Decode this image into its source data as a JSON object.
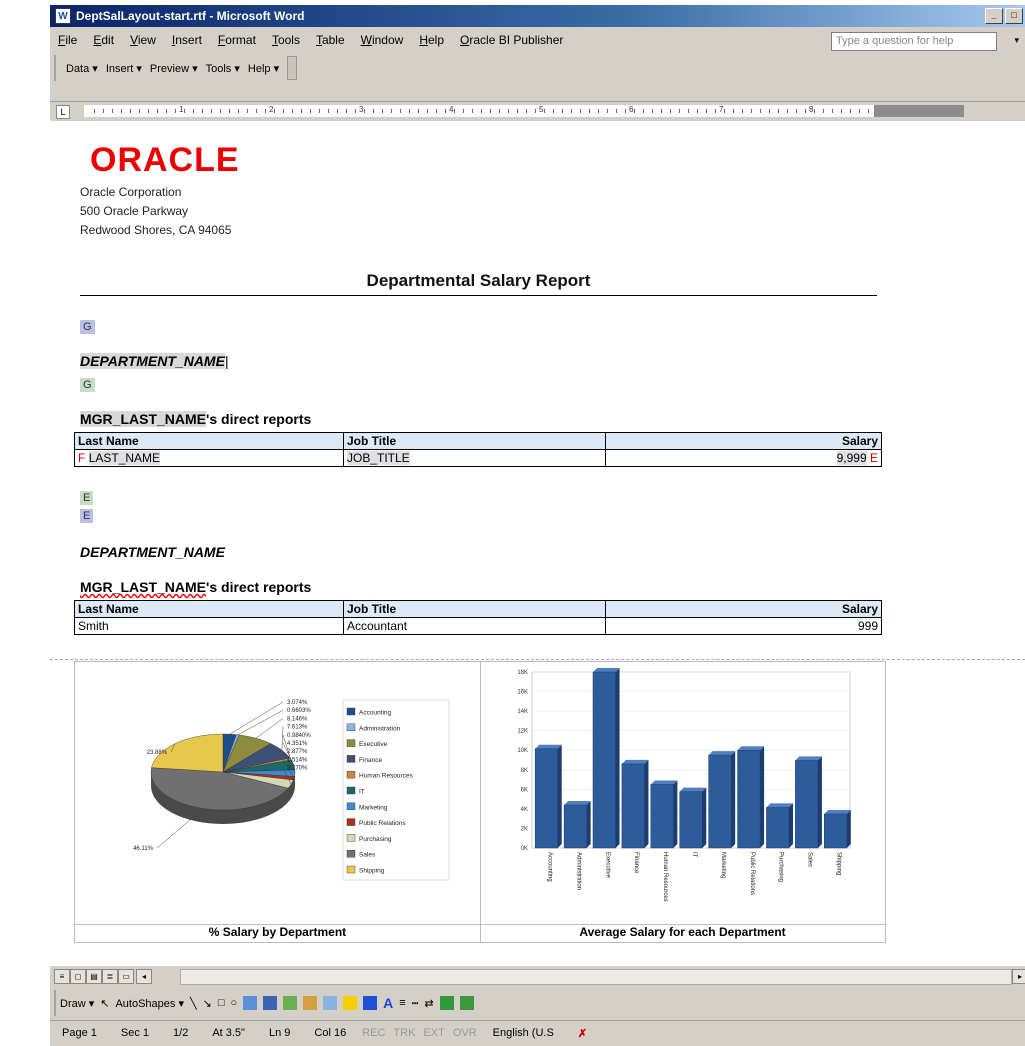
{
  "window": {
    "title": "DeptSalLayout-start.rtf - Microsoft Word"
  },
  "menu": [
    "File",
    "Edit",
    "View",
    "Insert",
    "Format",
    "Tools",
    "Table",
    "Window",
    "Help",
    "Oracle BI Publisher"
  ],
  "ask_placeholder": "Type a question for help",
  "bip_toolbar": [
    "Data ▾",
    "Insert ▾",
    "Preview ▾",
    "Tools ▾",
    "Help ▾"
  ],
  "document": {
    "logo": "ORACLE",
    "address": [
      "Oracle Corporation",
      "500 Oracle Parkway",
      "Redwood Shores, CA 94065"
    ],
    "report_title": "Departmental Salary Report",
    "field_g1": "G",
    "field_g2": "G",
    "field_e1": "E",
    "field_e2": "E",
    "dept_placeholder": "DEPARTMENT_NAME",
    "mgr_placeholder": "MGR_LAST_NAME",
    "mgr_suffix": "'s direct reports",
    "table1": {
      "headers": [
        "Last Name",
        "Job Title",
        "Salary"
      ],
      "row": {
        "f_tag": "F",
        "last_name": "LAST_NAME",
        "job_title": "JOB_TITLE",
        "salary": "9,999",
        "e_tag": "E"
      }
    },
    "dept_sample": "DEPARTMENT_NAME",
    "mgr_sample": "MGR_LAST_NAME",
    "mgr_sample_suffix": "'s direct reports",
    "table2": {
      "headers": [
        "Last Name",
        "Job Title",
        "Salary"
      ],
      "row": {
        "last_name": "Smith",
        "job_title": "Accountant",
        "salary": "999"
      }
    }
  },
  "chart_data": [
    {
      "type": "pie",
      "title": "% Salary by Department",
      "categories": [
        "Accounting",
        "Administration",
        "Executive",
        "Finance",
        "Human Resources",
        "IT",
        "Marketing",
        "Public Relations",
        "Purchasing",
        "Sales",
        "Shipping"
      ],
      "values": [
        3.074,
        0.6603,
        8.146,
        7.613,
        0.984,
        4.351,
        2.877,
        1.514,
        3.77,
        46.11,
        23.88
      ],
      "labels": [
        "3.074%",
        "0.6603%",
        "8.146%",
        "7.613%",
        "0.9840%",
        "4.351%",
        "2.877%",
        "1.514%",
        "3.770%",
        "46.11%",
        "23.88%"
      ],
      "colors": [
        "#1f4e8c",
        "#8ab4e0",
        "#8c8c3c",
        "#3c5078",
        "#c8883c",
        "#1a6a6a",
        "#3c8cd2",
        "#a8321e",
        "#d8d8b0",
        "#707070",
        "#e8c84c"
      ],
      "legend": "right"
    },
    {
      "type": "bar",
      "title": "Average Salary for each Department",
      "categories": [
        "Accounting",
        "Administration",
        "Executive",
        "Finance",
        "Human Resources",
        "IT",
        "Marketing",
        "Public Relations",
        "Purchasing",
        "Sales",
        "Shipping"
      ],
      "values": [
        10150,
        4400,
        19333,
        8600,
        6500,
        5760,
        9500,
        10000,
        4150,
        8956,
        3476
      ],
      "yticks": [
        "0K",
        "2K",
        "4K",
        "6K",
        "8K",
        "10K",
        "12K",
        "14K",
        "16K",
        "18K"
      ],
      "ylim": [
        0,
        18000
      ],
      "color": "#2c5c9c"
    }
  ],
  "status": {
    "page": "Page 1",
    "sec": "Sec 1",
    "pos": "1/2",
    "at": "At 3.5\"",
    "ln": "Ln 9",
    "col": "Col 16",
    "rec": "REC",
    "trk": "TRK",
    "ext": "EXT",
    "ovr": "OVR",
    "lang": "English (U.S"
  },
  "drawbar": {
    "draw": "Draw ▾",
    "autoshapes": "AutoShapes ▾"
  }
}
